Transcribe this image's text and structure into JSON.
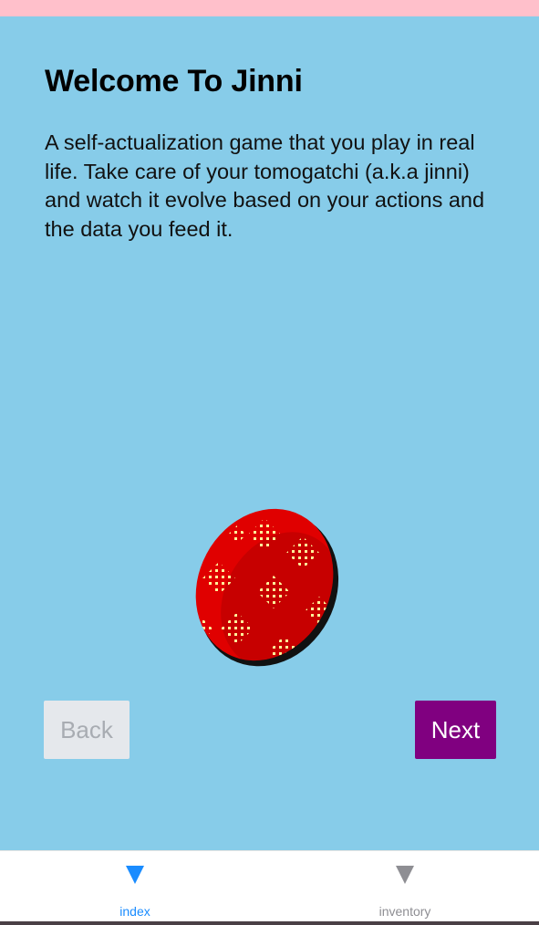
{
  "screen": {
    "title": "Welcome To Jinni",
    "description": "A self-actualization game that you play in real life. Take care of your tomogatchi (a.k.a jinni) and watch it evolve based on your actions and the data you feed it.",
    "egg_icon": "pixel-egg-icon"
  },
  "buttons": {
    "back_label": "Back",
    "next_label": "Next"
  },
  "tabbar": {
    "tabs": [
      {
        "label": "index",
        "icon": "triangle-down-icon",
        "active": true
      },
      {
        "label": "inventory",
        "icon": "triangle-down-icon",
        "active": false
      }
    ]
  },
  "colors": {
    "background": "#87CCE9",
    "top_strip": "#FFC0CB",
    "next_button": "#800080",
    "back_button": "#E5E8EC",
    "active_tab": "#1A8CFF",
    "inactive_tab": "#8E8E93",
    "egg_red": "#E00000",
    "egg_pattern": "#FFF59A"
  }
}
